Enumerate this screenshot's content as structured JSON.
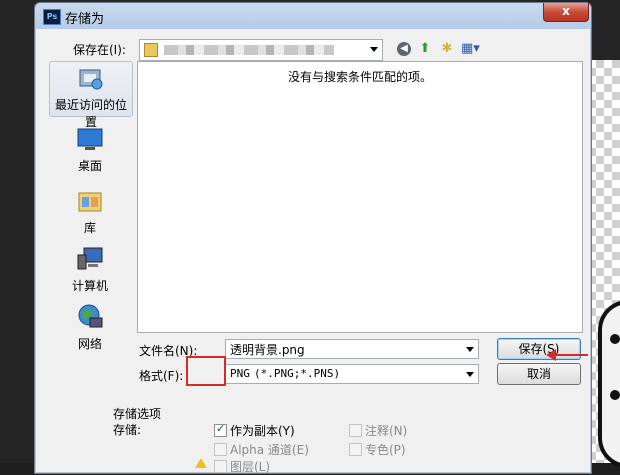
{
  "window": {
    "title": "存储为",
    "app_icon_text": "Ps",
    "close_label": "x"
  },
  "save_in": {
    "label": "保存在(I):",
    "path_value": ""
  },
  "toolbar": {
    "icons": [
      "back-icon",
      "up-folder-icon",
      "new-folder-icon",
      "view-menu-icon"
    ]
  },
  "places": [
    {
      "label": "最近访问的位置",
      "icon": "recent-places-icon"
    },
    {
      "label": "桌面",
      "icon": "desktop-icon"
    },
    {
      "label": "库",
      "icon": "libraries-icon"
    },
    {
      "label": "计算机",
      "icon": "computer-icon"
    },
    {
      "label": "网络",
      "icon": "network-icon"
    }
  ],
  "file_list": {
    "empty_message": "没有与搜索条件匹配的项。"
  },
  "filename": {
    "label": "文件名(N):",
    "value": "透明背景.png"
  },
  "format": {
    "label": "格式(F):",
    "value_prefix": "PNG",
    "value_rest": " (*.PNG;*.PNS)"
  },
  "buttons": {
    "save": "保存(S)",
    "cancel": "取消"
  },
  "options": {
    "group_title": "存储选项",
    "storage_label": "存储:",
    "as_copy": "作为副本(Y)",
    "notes": "注释(N)",
    "alpha": "Alpha 通道(E)",
    "spot": "专色(P)",
    "layers": "图层(L)"
  },
  "colors": {
    "highlight": "#d42a2a",
    "titlebar": "#c9daf0"
  }
}
